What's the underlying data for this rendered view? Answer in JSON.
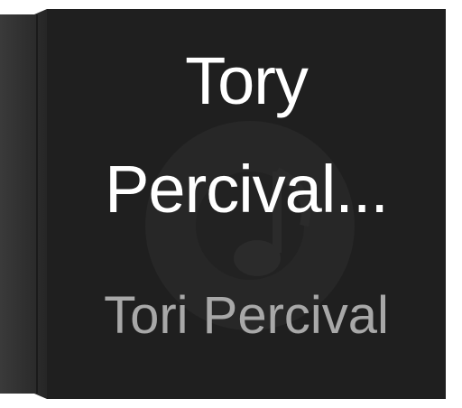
{
  "album_art": {
    "title_line1": "Tory",
    "title_line2": "Percival...",
    "artist": "Tori Percival",
    "placeholder_icon": "music-note-icon",
    "colors": {
      "background": "#1f1f1f",
      "title": "#ffffff",
      "artist": "#a8a8a8",
      "spine": "#333333"
    }
  }
}
